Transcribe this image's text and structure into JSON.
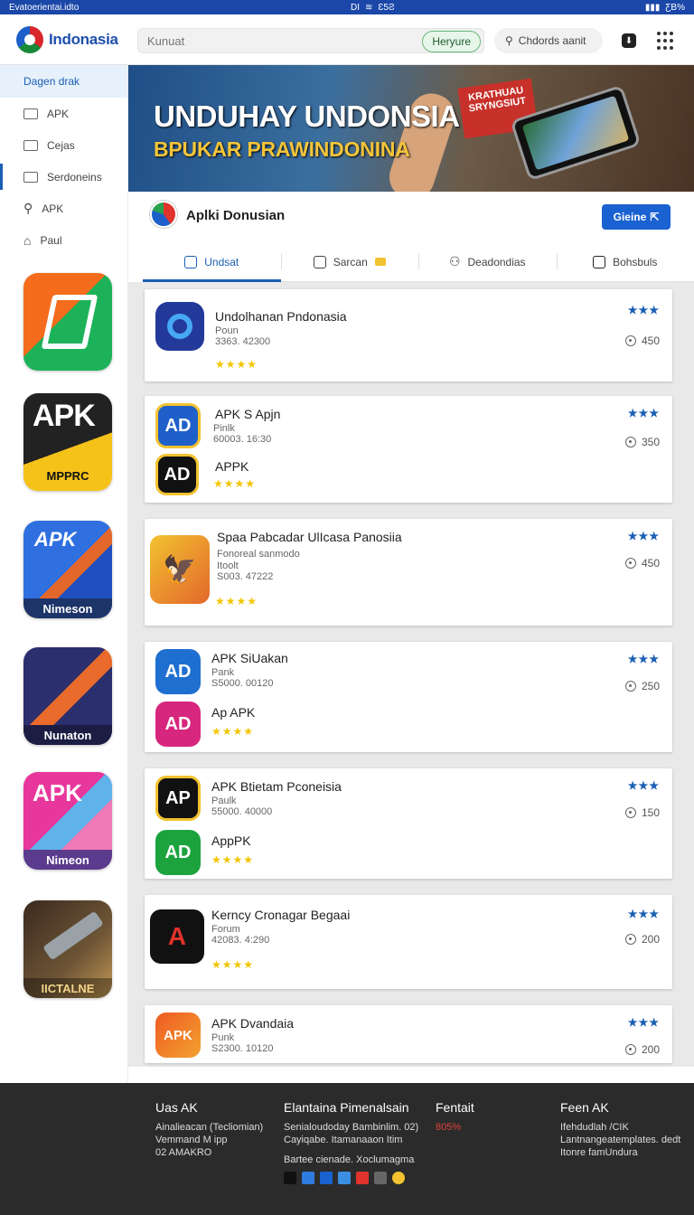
{
  "status_bar": {
    "left": "Evatoerientai.idto",
    "center": [
      "DI",
      "Ɛ5Ƨ"
    ],
    "right": "ƸB%"
  },
  "header": {
    "brand": "Indonasia",
    "search_placeholder": "Kunuat",
    "search_button": "Heryure",
    "search2_label": "Chdords aanit"
  },
  "sidebar": {
    "items": [
      {
        "label": "Dagen drak",
        "icon": "none"
      },
      {
        "label": "APK",
        "icon": "folder-icon"
      },
      {
        "label": "Cejas",
        "icon": "folder-icon"
      },
      {
        "label": "Serdoneins",
        "icon": "folder-icon"
      },
      {
        "label": "APK",
        "icon": "search-icon"
      },
      {
        "label": "Paul",
        "icon": "home-icon"
      }
    ],
    "thumbs": [
      {
        "caption": "",
        "top_text": "",
        "bg": "#1db25a"
      },
      {
        "caption": "MPPRC",
        "top_text": "APK",
        "bg": "#222222"
      },
      {
        "caption": "Nimeson",
        "top_text": "APK",
        "bg": "#1f4fbf"
      },
      {
        "caption": "Nunaton",
        "top_text": "",
        "bg": "#2c2f6e"
      },
      {
        "caption": "Nimeon",
        "top_text": "APK",
        "bg": "#e8379c"
      },
      {
        "caption": "IICTALNE",
        "top_text": "",
        "bg": "#3a2a1e"
      }
    ]
  },
  "banner": {
    "line1": "UNDUHAY UNDONSIA",
    "line2": "BPUKAR PRAWINDONINA",
    "sign": "KRATHUAU SRYNGSIUT"
  },
  "profile": {
    "name": "Aplki Donusian",
    "follow_label": "Gieine"
  },
  "tabs": [
    {
      "label": "Undsat",
      "icon": "upload-icon"
    },
    {
      "label": "Sarcan",
      "icon": "edit-icon"
    },
    {
      "label": "Deadondias",
      "icon": "people-icon"
    },
    {
      "label": "Bohsbuls",
      "icon": "box-icon"
    }
  ],
  "cards": [
    {
      "title": "Undolhanan Pndonasia",
      "sub1": "Poun",
      "sub2": "3363. 42300",
      "extra_title": "",
      "stars": "★★★★",
      "rating": "★★★",
      "downloads": "450",
      "icon_text": "O",
      "icon_color": "#1e5fc9",
      "icon2_text": "",
      "icon2_color": ""
    },
    {
      "title": "APK S Apjn",
      "sub1": "Pinlk",
      "sub2": "60003. 16:30",
      "extra_title": "APPK",
      "stars": "★★★★",
      "rating": "★★★",
      "downloads": "350",
      "icon_text": "AD",
      "icon_color": "#1e5fc9",
      "icon2_text": "AD",
      "icon2_color": "#111111"
    },
    {
      "title": "Spaa Pabcadar UlIcasa Panosiia",
      "sub1": "Fonoreal sanmodo",
      "sub2": "Itoolt",
      "sub3": "S003. 47222",
      "extra_title": "",
      "stars": "★★★★",
      "rating": "★★★",
      "downloads": "450",
      "icon_text": "🦅",
      "icon_color": "#f2c230",
      "icon2_text": "",
      "icon2_color": ""
    },
    {
      "title": "APK SiUakan",
      "sub1": "Pank",
      "sub2": "S5000. 00120",
      "extra_title": "Ap APK",
      "stars": "★★★★",
      "rating": "★★★",
      "downloads": "250",
      "icon_text": "AD",
      "icon_color": "#1e6fd0",
      "icon2_text": "AD",
      "icon2_color": "#d6267e"
    },
    {
      "title": "APK Btietam Pconeisia",
      "sub1": "Paulk",
      "sub2": "55000. 40000",
      "extra_title": "AppPK",
      "stars": "★★★★",
      "rating": "★★★",
      "downloads": "150",
      "icon_text": "AP",
      "icon_color": "#111111",
      "icon2_text": "AD",
      "icon2_color": "#1ca33e"
    },
    {
      "title": "Kerncy Cronagar Begaai",
      "sub1": "Forum",
      "sub2": "42083. 4:290",
      "extra_title": "",
      "stars": "★★★★",
      "rating": "★★★",
      "downloads": "200",
      "icon_text": "A",
      "icon_color": "#111111",
      "icon2_text": "",
      "icon2_color": ""
    },
    {
      "title": "APK Dvandaia",
      "sub1": "Punk",
      "sub2": "S2300. 10120",
      "extra_title": "",
      "stars": "",
      "rating": "★★★",
      "downloads": "200",
      "icon_text": "APK",
      "icon_color": "#f05a23",
      "icon2_text": "",
      "icon2_color": ""
    }
  ],
  "footer": {
    "col1": {
      "title": "Uas AK",
      "lines": [
        "Ainalieacan (Tecliomian)",
        "Vemmand M ipp",
        "02 AMAKRO"
      ]
    },
    "col2": {
      "title": "Elantaina Pimenalsain",
      "lines": [
        "Senialoudoday Bambinlim. 02)",
        "Cayiqabe. Itamanaaon Itim",
        "Bartee cienade. Xoclumagma"
      ]
    },
    "col3": {
      "title": "Fentait",
      "lines": [
        "805%"
      ]
    },
    "col4": {
      "title": "Feen AK",
      "lines": [
        "Ifehdudlah /CIK",
        "Lantnangeatemplates. dedt",
        "Itonre famUndura"
      ]
    }
  }
}
